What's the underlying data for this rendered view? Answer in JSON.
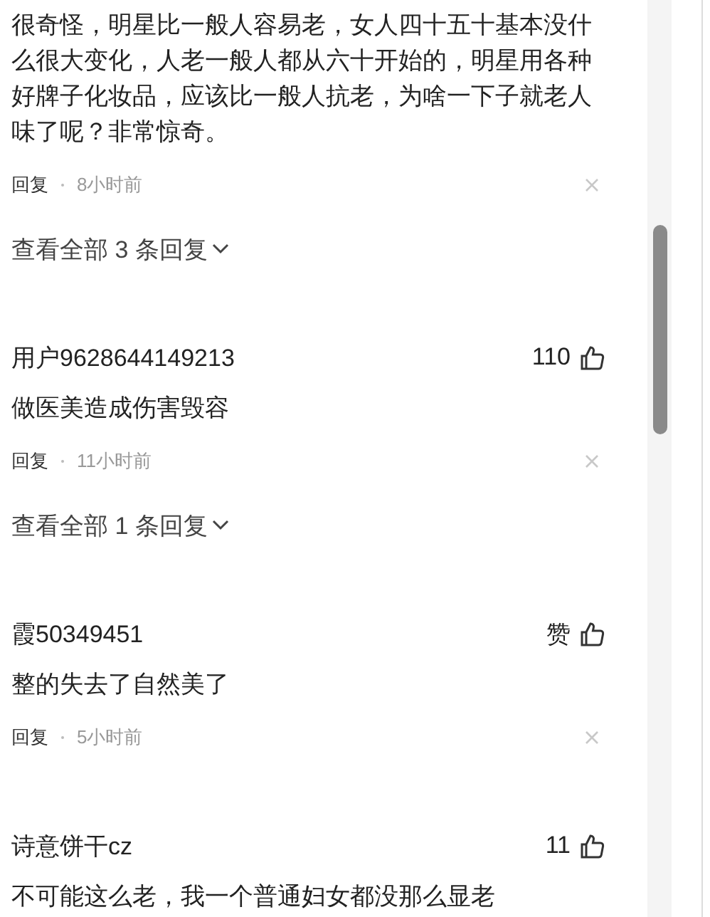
{
  "comments": [
    {
      "text": "很奇怪，明星比一般人容易老，女人四十五十基本没什么很大变化，人老一般人都从六十开始的，明星用各种好牌子化妆品，应该比一般人抗老，为啥一下子就老人味了呢？非常惊奇。",
      "reply_label": "回复",
      "time": "8小时前",
      "replies_link": "查看全部 3 条回复"
    },
    {
      "user": "用户9628644149213",
      "likes": "110",
      "text": "做医美造成伤害毁容",
      "reply_label": "回复",
      "time": "11小时前",
      "replies_link": "查看全部 1 条回复"
    },
    {
      "user": "霞50349451",
      "likes": "赞",
      "text": "整的失去了自然美了",
      "reply_label": "回复",
      "time": "5小时前"
    },
    {
      "user": "诗意饼干cz",
      "likes": "11",
      "text": "不可能这么老，我一个普通妇女都没那么显老"
    }
  ]
}
